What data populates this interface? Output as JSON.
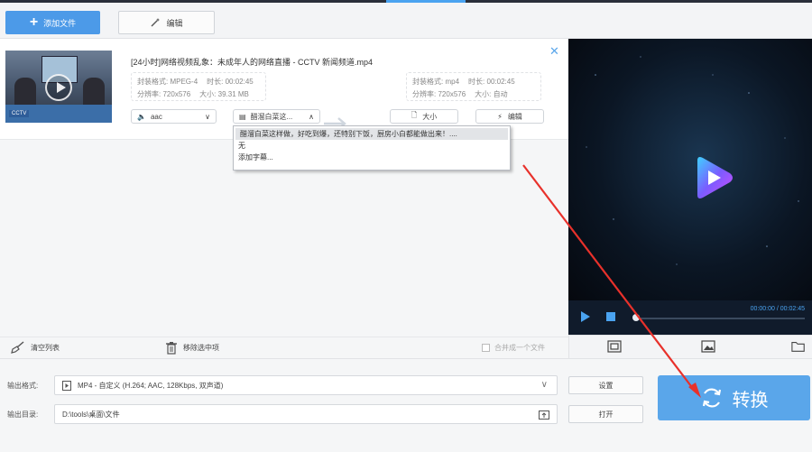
{
  "toolbar": {
    "add_file_label": "添加文件",
    "edit_label": "编辑"
  },
  "file": {
    "name": "[24小时]网络视频乱象：未成年人的网络直播 - CCTV 新闻频道.mp4",
    "thumb_logo": "CCTV",
    "source": {
      "format_label": "封装格式:",
      "format_value": "MPEG-4",
      "duration_label": "时长:",
      "duration_value": "00:02:45",
      "resolution_label": "分辨率:",
      "resolution_value": "720x576",
      "size_label": "大小:",
      "size_value": "39.31 MB"
    },
    "target": {
      "format_label": "封装格式:",
      "format_value": "mp4",
      "duration_label": "时长:",
      "duration_value": "00:02:45",
      "resolution_label": "分辨率:",
      "resolution_value": "720x576",
      "size_label": "大小:",
      "size_value": "自动"
    },
    "audio_track": "aac",
    "subtitle_selected": "醋溜白菜这...",
    "size_button": "大小",
    "edit_button": "编辑"
  },
  "subtitle_dropdown": {
    "options": [
      "醋溜白菜这样做，好吃到爆，还特别下饭，厨房小白都能做出来！....",
      "无",
      "添加字幕..."
    ]
  },
  "actions": {
    "clear_list": "清空列表",
    "remove_selected": "移除选中项",
    "merge_label": "合并成一个文件"
  },
  "player": {
    "time": "00:00:00 / 00:02:45",
    "progress": 0
  },
  "output": {
    "format_label": "输出格式:",
    "format_value": "MP4 - 自定义 (H.264; AAC, 128Kbps, 双声道)",
    "dir_label": "输出目录:",
    "dir_value": "D:\\tools\\桌面\\文件",
    "settings_button": "设置",
    "open_button": "打开",
    "convert_button": "转换"
  },
  "colors": {
    "accent": "#4c9ae8",
    "annotation": "#e8312b"
  }
}
